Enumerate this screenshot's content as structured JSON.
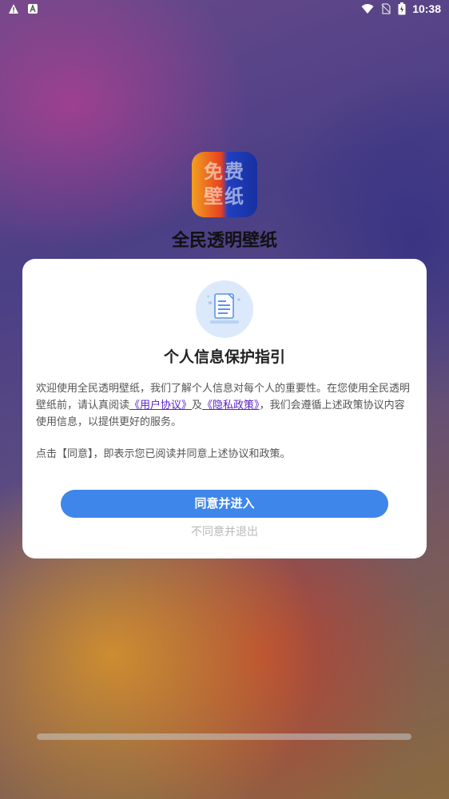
{
  "status_bar": {
    "time": "10:38",
    "left_icons": [
      "warning-icon",
      "app-a-icon"
    ],
    "right_icons": [
      "wifi-icon",
      "no-sim-icon",
      "battery-icon"
    ]
  },
  "app": {
    "icon_text": "免费\n壁纸",
    "name": "全民透明壁纸"
  },
  "dialog": {
    "title": "个人信息保护指引",
    "body_prefix": "欢迎使用全民透明壁纸，我们了解个人信息对每个人的重要性。在您使用全民透明壁纸前，请认真阅读",
    "user_agreement_link": "《用户协议》",
    "conjunction": "及",
    "privacy_policy_link": "《隐私政策》",
    "body_suffix": "，我们会遵循上述政策协议内容使用信息，以提供更好的服务。",
    "note": "点击【同意】，即表示您已阅读并同意上述协议和政策。",
    "agree_label": "同意并进入",
    "disagree_label": "不同意并退出"
  },
  "colors": {
    "primary_button": "#3f86ea",
    "link": "#5b22c8",
    "dialog_bg": "#ffffff",
    "disabled_text": "#b9b9b9"
  }
}
